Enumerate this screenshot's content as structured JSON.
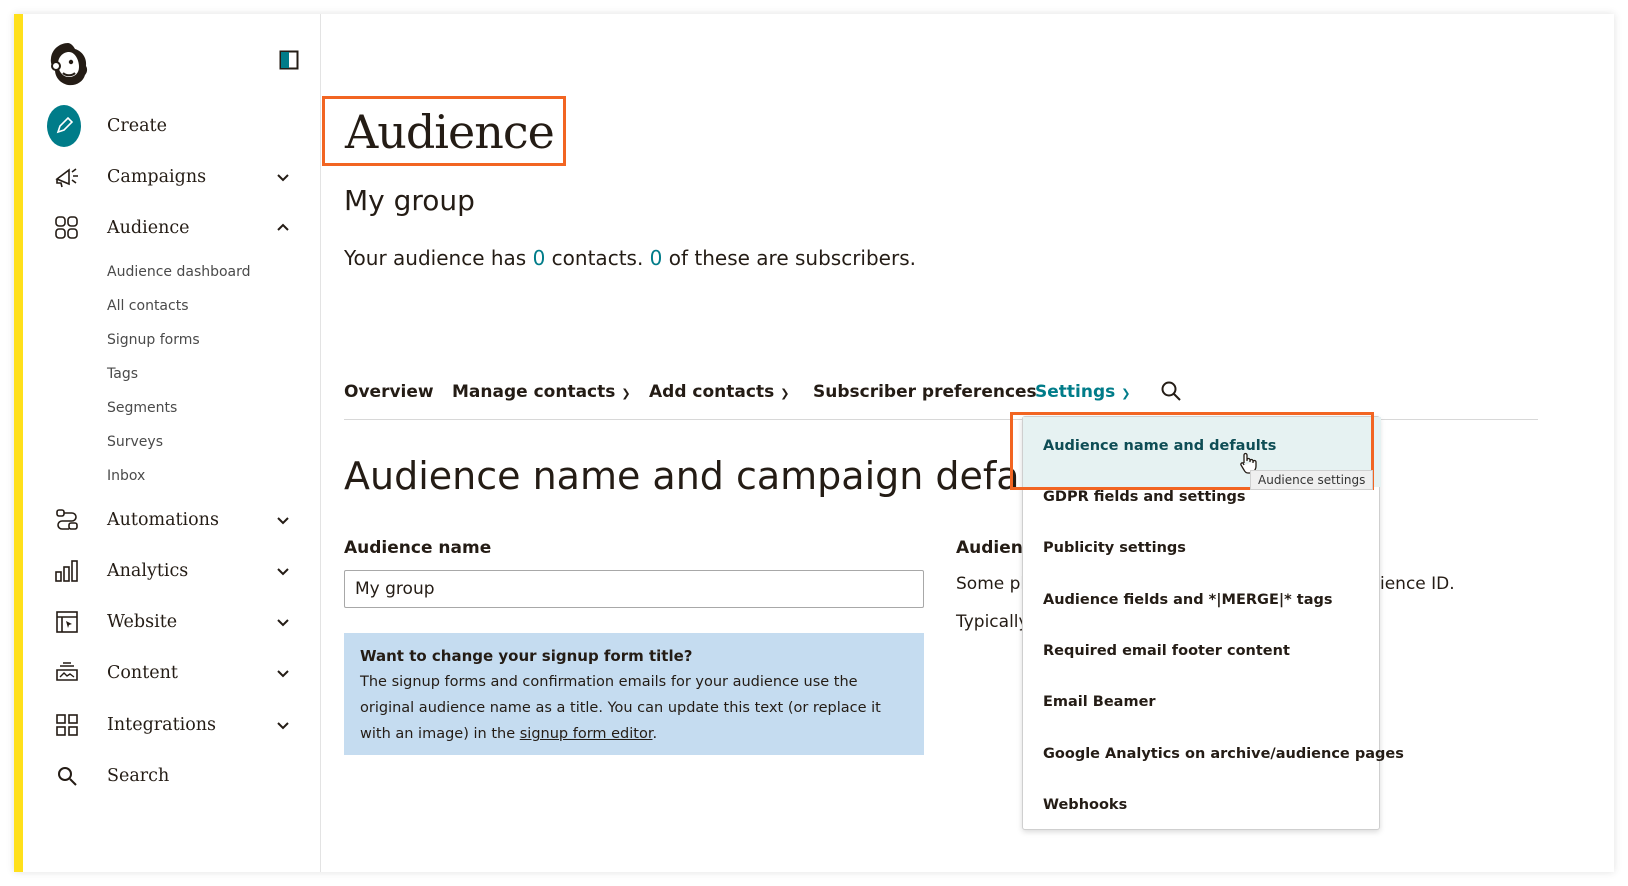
{
  "sidebar": {
    "nav": [
      {
        "label": "Create",
        "icon": "pencil-icon"
      },
      {
        "label": "Campaigns",
        "icon": "megaphone-icon",
        "expandable": true
      },
      {
        "label": "Audience",
        "icon": "audience-icon",
        "expanded": true
      },
      {
        "label": "Automations",
        "icon": "automations-icon",
        "expandable": true
      },
      {
        "label": "Analytics",
        "icon": "analytics-icon",
        "expandable": true
      },
      {
        "label": "Website",
        "icon": "website-icon",
        "expandable": true
      },
      {
        "label": "Content",
        "icon": "content-icon",
        "expandable": true
      },
      {
        "label": "Integrations",
        "icon": "integrations-icon",
        "expandable": true
      },
      {
        "label": "Search",
        "icon": "search-icon"
      }
    ],
    "audience_sub": [
      "Audience dashboard",
      "All contacts",
      "Signup forms",
      "Tags",
      "Segments",
      "Surveys",
      "Inbox"
    ]
  },
  "main": {
    "title": "Audience",
    "subtitle": "My group",
    "summary_prefix": "Your audience has ",
    "contacts_count": "0",
    "summary_middle": " contacts. ",
    "subscribers_count": "0",
    "summary_suffix": " of these are subscribers.",
    "tabs": [
      {
        "label": "Overview"
      },
      {
        "label": "Manage contacts",
        "dropdown": true
      },
      {
        "label": "Add contacts",
        "dropdown": true
      },
      {
        "label": "Subscriber preferences"
      },
      {
        "label": "Settings",
        "dropdown": true,
        "active": true
      }
    ],
    "section_title": "Audience name and campaign defaults",
    "audience_name_label": "Audience name",
    "audience_name_value": "My group",
    "info": {
      "title": "Want to change your signup form title?",
      "body": "The signup forms and confirmation emails for your audience use the original audience name as a title. You can update this text (or replace it with an image) in the ",
      "link": "signup form editor",
      "end": "."
    },
    "right_col": {
      "label": "Audienc",
      "text1": "Some pl",
      "text2": "Typically",
      "tail": "ience ID."
    }
  },
  "dropdown": {
    "items": [
      "Audience name and defaults",
      "GDPR fields and settings",
      "Publicity settings",
      "Audience fields and *|MERGE|* tags",
      "Required email footer content",
      "Email Beamer",
      "Google Analytics on archive/audience pages",
      "Webhooks"
    ],
    "tooltip": "Audience settings"
  },
  "colors": {
    "accent": "#007c89",
    "highlight": "#f26522",
    "brand_yellow": "#ffe01b",
    "info_bg": "#c5dcf0"
  }
}
